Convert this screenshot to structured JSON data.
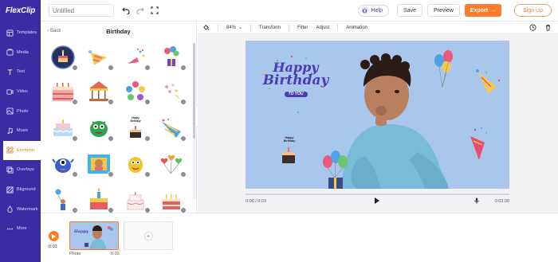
{
  "app": {
    "brand_logo": "FlexClip",
    "project_title_placeholder": "Untitled"
  },
  "header": {
    "help_label": "Help",
    "save_label": "Save",
    "preview_label": "Preview",
    "export_label": "Export",
    "signup_label": "Sign Up"
  },
  "sidebar": {
    "items": [
      {
        "label": "Templates",
        "icon": "templates-icon"
      },
      {
        "label": "Media",
        "icon": "media-icon"
      },
      {
        "label": "Text",
        "icon": "text-icon"
      },
      {
        "label": "Video",
        "icon": "video-icon"
      },
      {
        "label": "Photo",
        "icon": "photo-icon"
      },
      {
        "label": "Music",
        "icon": "music-icon"
      },
      {
        "label": "Elements",
        "icon": "elements-icon"
      },
      {
        "label": "Overlays",
        "icon": "overlays-icon"
      },
      {
        "label": "Bkground",
        "icon": "background-icon"
      },
      {
        "label": "Watermark",
        "icon": "watermark-icon"
      },
      {
        "label": "More",
        "icon": "more-icon"
      }
    ],
    "active": "Elements"
  },
  "panel": {
    "back_label": "Back",
    "title": "Birthday",
    "cake_label": "Happy Birthday"
  },
  "toolbar": {
    "zoom": "84%",
    "transform_label": "Transform",
    "filter_label": "Filter",
    "adjust_label": "Adjust",
    "animation_label": "Animation"
  },
  "canvas": {
    "headline_1": "Happy",
    "headline_2": "Birthday",
    "headline_3": "TO YOU",
    "sticker_text": "Happy Birthday",
    "background_color": "#a9c6ec"
  },
  "player": {
    "current": "0:00 / 0:03",
    "end": "0:03.00"
  },
  "timeline": {
    "current_time": "0:03",
    "clip_label": "Photo",
    "clip_duration": "0:03"
  },
  "colors": {
    "brand": "#3a2da3",
    "accent": "#ff7b2e"
  }
}
